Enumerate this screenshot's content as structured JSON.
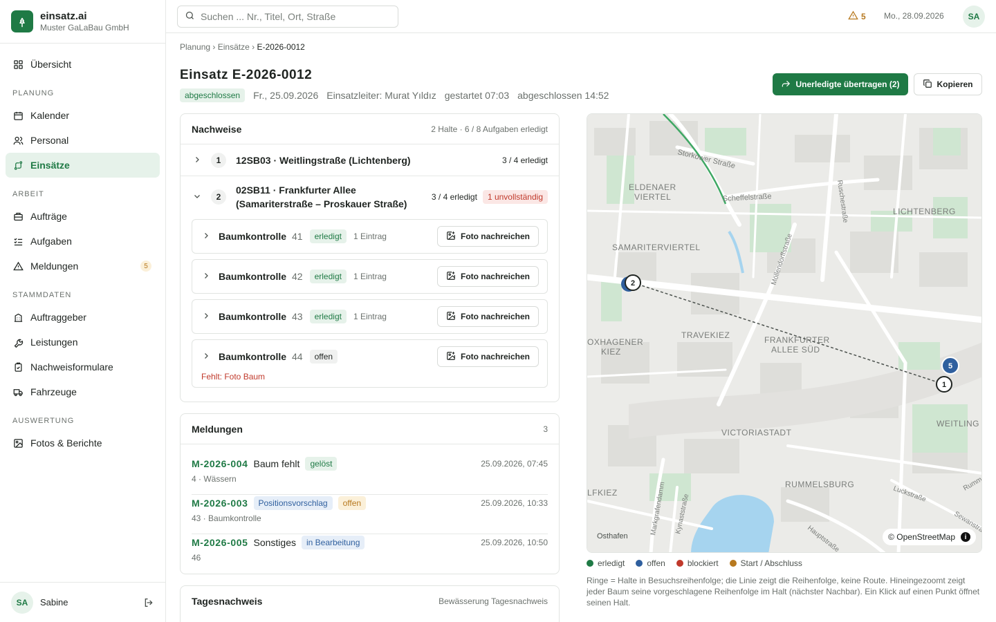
{
  "brand": {
    "name": "einsatz.ai",
    "org": "Muster GaLaBau GmbH"
  },
  "nav": {
    "overview": "Übersicht",
    "sections": {
      "planung": "PLANUNG",
      "arbeit": "ARBEIT",
      "stammdaten": "STAMMDATEN",
      "auswertung": "AUSWERTUNG"
    },
    "kalender": "Kalender",
    "personal": "Personal",
    "einsaetze": "Einsätze",
    "auftraege": "Aufträge",
    "aufgaben": "Aufgaben",
    "meldungen": "Meldungen",
    "meldungen_badge": "5",
    "auftraggeber": "Auftraggeber",
    "leistungen": "Leistungen",
    "nachweisformulare": "Nachweisformulare",
    "fahrzeuge": "Fahrzeuge",
    "fotos": "Fotos & Berichte"
  },
  "user": {
    "initials": "SA",
    "name": "Sabine"
  },
  "topbar": {
    "search_placeholder": "Suchen ... Nr., Titel, Ort, Straße",
    "alerts_count": "5",
    "date": "Mo., 28.09.2026",
    "avatar": "SA"
  },
  "breadcrumb": {
    "a": "Planung",
    "sep1": "›",
    "b": "Einsätze",
    "sep2": "›",
    "current": "E-2026-0012"
  },
  "einsatz": {
    "title": "Einsatz E-2026-0012",
    "status": "abgeschlossen",
    "date": "Fr., 25.09.2026",
    "leader": "Einsatzleiter: Murat Yıldız",
    "started": "gestartet 07:03",
    "finished": "abgeschlossen 14:52"
  },
  "actions": {
    "transfer": "Unerledigte übertragen (2)",
    "copy": "Kopieren"
  },
  "nachweise": {
    "title": "Nachweise",
    "summary": "2 Halte · 6 / 8 Aufgaben erledigt",
    "halte": [
      {
        "num": "1",
        "title": "12SB03 · Weitlingstraße (Lichtenberg)",
        "count": "3 / 4 erledigt"
      },
      {
        "num": "2",
        "title_line1": "02SB11 · Frankfurter Allee",
        "title_line2": "(Samariterstraße – Proskauer Straße)",
        "count": "3 / 4 erledigt",
        "badge": "1 unvollständig"
      }
    ],
    "tasks": [
      {
        "name": "Baumkontrolle",
        "num": "41",
        "status": "erledigt",
        "entries": "1 Eintrag",
        "action": "Foto nachreichen"
      },
      {
        "name": "Baumkontrolle",
        "num": "42",
        "status": "erledigt",
        "entries": "1 Eintrag",
        "action": "Foto nachreichen"
      },
      {
        "name": "Baumkontrolle",
        "num": "43",
        "status": "erledigt",
        "entries": "1 Eintrag",
        "action": "Foto nachreichen"
      },
      {
        "name": "Baumkontrolle",
        "num": "44",
        "status": "offen",
        "missing": "Fehlt: Foto Baum",
        "action": "Foto nachreichen"
      }
    ]
  },
  "meldungen": {
    "title": "Meldungen",
    "count": "3",
    "items": [
      {
        "id": "M-2026-004",
        "title": "Baum fehlt",
        "status": "gelöst",
        "sub": "4 · Wässern",
        "time": "25.09.2026, 07:45"
      },
      {
        "id": "M-2026-003",
        "title": "",
        "status": "Positionsvorschlag",
        "status2": "offen",
        "sub": "43 · Baumkontrolle",
        "time": "25.09.2026, 10:33"
      },
      {
        "id": "M-2026-005",
        "title": "Sonstiges",
        "status": "in Bearbeitung",
        "sub": "46",
        "time": "25.09.2026, 10:50"
      }
    ]
  },
  "tagesnachweis": {
    "title": "Tagesnachweis",
    "sub": "Bewässerung Tagesnachweis"
  },
  "map": {
    "labels": {
      "storkower": "Storkower Straße",
      "eldenaer1": "ELDENAER",
      "eldenaer2": "VIERTEL",
      "scheffel": "Scheffelstraße",
      "ruschestr": "Ruschestraße",
      "lichtenberg": "LICHTENBERG",
      "samariter": "SAMARITERVIERTEL",
      "moellendorff": "Möllendorffstraße",
      "travekiez": "TRAVEKIEZ",
      "frankfurter1": "FRANKFURTER",
      "frankfurter2": "ALLEE SÜD",
      "boxhagener1": "OXHAGENER",
      "boxhagener2": "KIEZ",
      "weitling": "WEITLING",
      "victoriastadt": "VICTORIASTADT",
      "rummelsburg": "RUMMELSBURG",
      "lfkiez": "LFKIEZ",
      "markgrafendamm": "Markgrafendamm",
      "kynaststr": "Kynaststraße",
      "hauptstr": "Hauptstraße",
      "luckstr": "Luckstraße",
      "sewanstr": "Sewanstra",
      "rumme": "Rumme",
      "osthafen": "Osthafen"
    },
    "markers": [
      "1",
      "2",
      "5"
    ],
    "attribution": "© OpenStreetMap",
    "info": "i"
  },
  "legend": {
    "done": "erledigt",
    "open": "offen",
    "blocked": "blockiert",
    "start": "Start / Abschluss"
  },
  "colors": {
    "done": "#1f7a45",
    "open": "#2f5f9e",
    "blocked": "#c0392b",
    "start": "#b7791f"
  },
  "map_note": "Ringe = Halte in Besuchsreihenfolge; die Linie zeigt die Reihenfolge, keine Route. Hineingezoomt zeigt jeder Baum seine vorgeschlagene Reihenfolge im Halt (nächster Nachbar). Ein Klick auf einen Punkt öffnet seinen Halt."
}
